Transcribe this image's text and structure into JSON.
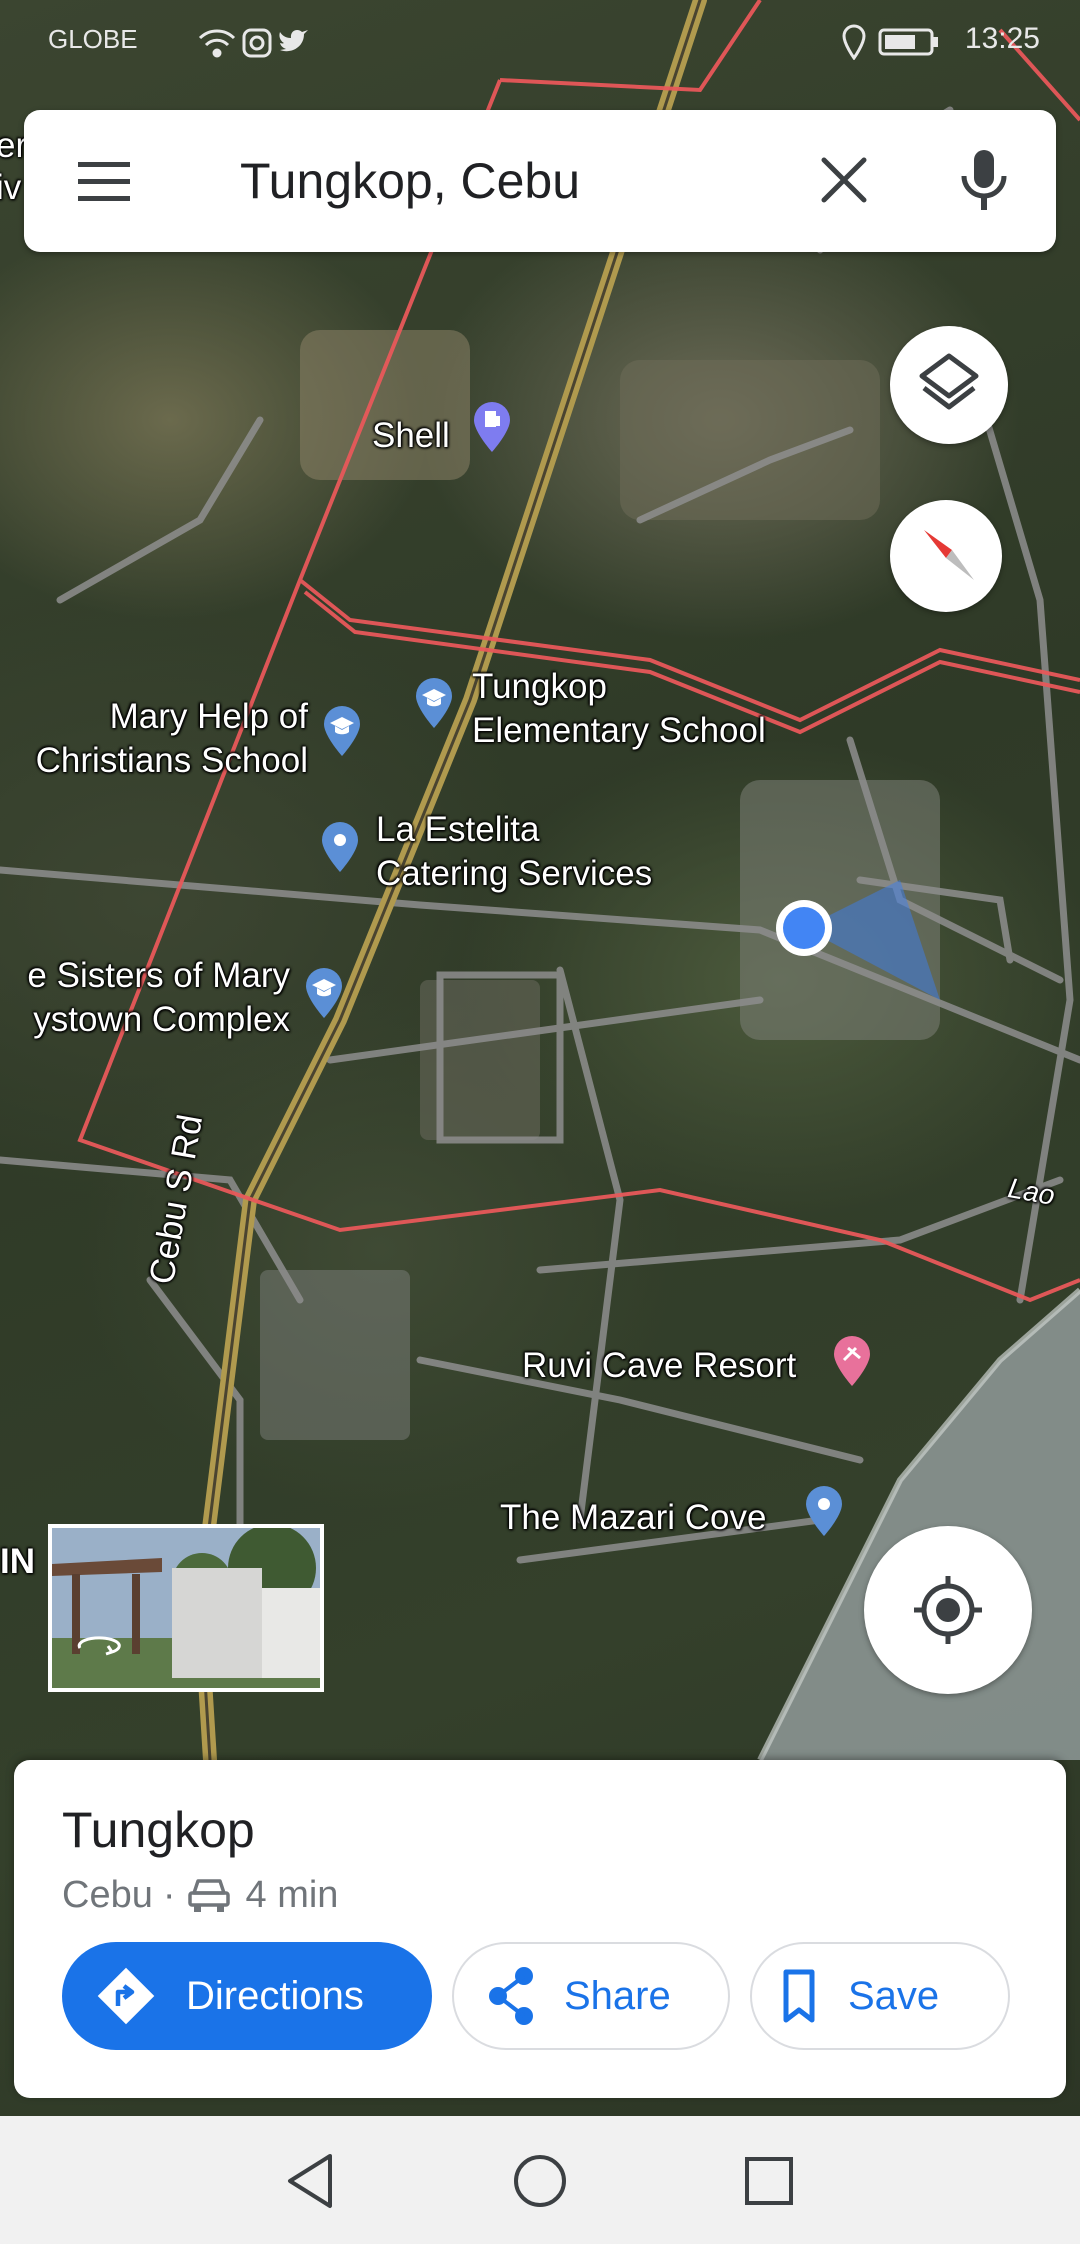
{
  "status_bar": {
    "carrier": "GLOBE",
    "time": "13:25"
  },
  "search": {
    "query": "Tungkop, Cebu"
  },
  "map": {
    "pois": [
      {
        "id": "shell",
        "label": "Shell",
        "type": "gas-station"
      },
      {
        "id": "tungkop-school",
        "label_lines": [
          "Tungkop",
          "Elementary School"
        ],
        "type": "school"
      },
      {
        "id": "mary-help",
        "label_lines": [
          "Mary Help of",
          "Christians School"
        ],
        "type": "school"
      },
      {
        "id": "la-estelita",
        "label_lines": [
          "La Estelita",
          "Catering Services"
        ],
        "type": "place"
      },
      {
        "id": "sisters-mary",
        "label_lines": [
          "e Sisters of Mary",
          "ystown Complex"
        ],
        "type": "school"
      },
      {
        "id": "ruvi",
        "label": "Ruvi Cave Resort",
        "type": "resort"
      },
      {
        "id": "mazari",
        "label": "The Mazari Cove",
        "type": "place"
      }
    ],
    "road_label": "Cebu S Rd",
    "edge_labels": {
      "lao": "Lao",
      "in": "IN",
      "top_left_1": "er",
      "top_left_2": "iv"
    }
  },
  "place_card": {
    "title": "Tungkop",
    "subtitle_place": "Cebu",
    "separator": "·",
    "travel_time": "4 min",
    "buttons": {
      "directions": "Directions",
      "share": "Share",
      "save": "Save"
    }
  },
  "colors": {
    "accent": "#1a73e8",
    "boundary": "#e8585a",
    "road_main": "#b09a4e"
  },
  "icons": [
    "menu-icon",
    "close-icon",
    "mic-icon",
    "layers-icon",
    "compass-icon",
    "my-location-icon",
    "car-icon",
    "directions-icon",
    "share-icon",
    "bookmark-icon",
    "back-icon",
    "home-icon",
    "recents-icon"
  ]
}
